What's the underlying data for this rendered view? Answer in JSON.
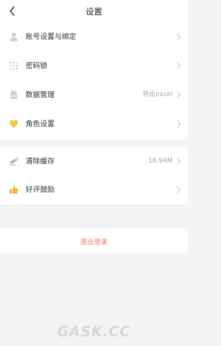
{
  "header": {
    "title": "设置",
    "back_icon": "chevron-left-icon"
  },
  "groups": [
    {
      "items": [
        {
          "label": "账号设置与绑定",
          "value": "",
          "icon": "user-icon"
        },
        {
          "label": "密码锁",
          "value": "",
          "icon": "grid-dots-icon"
        },
        {
          "label": "数据管理",
          "value": "导出excel",
          "icon": "document-icon"
        },
        {
          "label": "角色设置",
          "value": "",
          "icon": "heart-icon"
        }
      ]
    },
    {
      "items": [
        {
          "label": "清除缓存",
          "value": "16.94M",
          "icon": "broom-icon"
        },
        {
          "label": "好评鼓励",
          "value": "",
          "icon": "thumbs-up-icon"
        }
      ]
    }
  ],
  "logout": {
    "label": "退出登录"
  },
  "watermark": "GASK.CC",
  "colors": {
    "background": "#f3f4f6",
    "card": "#ffffff",
    "icon_gray": "#c9cdd6",
    "heart_yellow": "#f6c342",
    "thumb_yellow": "#f3b53a",
    "broom_blue": "#aab5cf",
    "logout_red": "#e8826a",
    "value_gray": "#a8a8a8"
  }
}
